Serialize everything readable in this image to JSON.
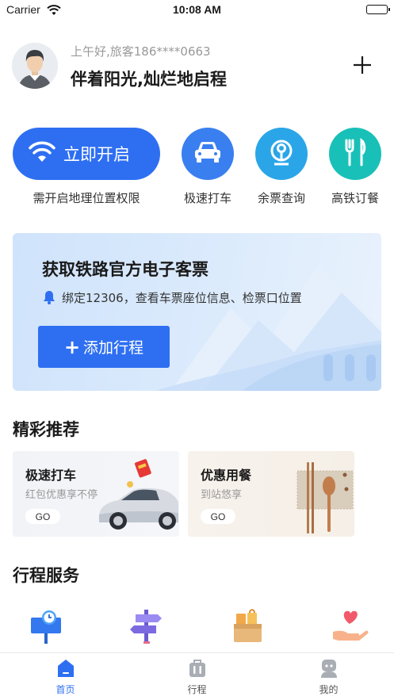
{
  "status_bar": {
    "carrier": "Carrier",
    "time": "10:08 AM"
  },
  "header": {
    "greeting": "上午好,旅客186****0663",
    "slogan": "伴着阳光,灿烂地启程"
  },
  "quick_actions": {
    "locate_button": "立即开启",
    "locate_caption": "需开启地理位置权限",
    "items": [
      {
        "label": "极速打车",
        "icon": "car-icon",
        "color": "#3a7ff0"
      },
      {
        "label": "余票查询",
        "icon": "railway-logo-icon",
        "color": "#2aa6e8"
      },
      {
        "label": "高铁订餐",
        "icon": "fork-knife-icon",
        "color": "#19c0b8"
      }
    ]
  },
  "banner": {
    "title": "获取铁路官方电子客票",
    "subtitle": "绑定12306，查看车票座位信息、检票口位置",
    "button": "添加行程"
  },
  "recommend": {
    "title": "精彩推荐",
    "cards": [
      {
        "title": "极速打车",
        "subtitle": "红包优惠享不停",
        "go": "GO"
      },
      {
        "title": "优惠用餐",
        "subtitle": "到站悠享",
        "go": "GO"
      }
    ]
  },
  "services": {
    "title": "行程服务",
    "icons": [
      "clock-sign-icon",
      "signpost-icon",
      "shopping-bag-icon",
      "heart-hand-icon"
    ]
  },
  "tab_bar": {
    "tabs": [
      {
        "label": "首页",
        "active": true
      },
      {
        "label": "行程",
        "active": false
      },
      {
        "label": "我的",
        "active": false
      }
    ]
  },
  "colors": {
    "accent": "#2e6ff2"
  }
}
